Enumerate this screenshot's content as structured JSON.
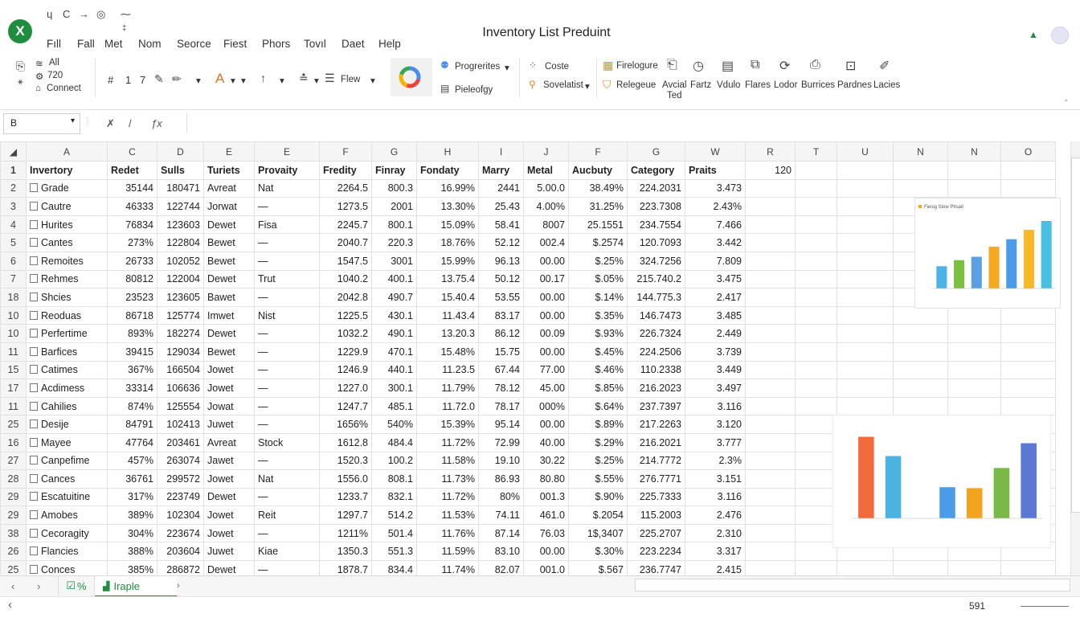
{
  "window": {
    "title": "Inventory List Preduint",
    "app_icon": "X",
    "quick_access": [
      "ɥ",
      "C",
      "→",
      "◎",
      "⁓"
    ]
  },
  "menu": [
    "Fıll",
    "Fall",
    "Met",
    "Nom",
    "Seorce",
    "Fiest",
    "Phors",
    "Tovıl",
    "Daet",
    "Help"
  ],
  "ribbon": {
    "connect_group": {
      "all": "All",
      "value": "720",
      "connect": "Connect"
    },
    "format_items": [
      "#",
      "1",
      "7"
    ],
    "view_label": "Flew",
    "progresses_label": "Progrerites",
    "pieologry_label": "Pieleofgy",
    "costs_label": "Coste",
    "sovelatist_label": "Sovelatist",
    "big_buttons": [
      {
        "label": "Firelogure",
        "icon": "table-icon"
      },
      {
        "label": "Relegeue",
        "icon": "filter-icon"
      },
      {
        "label": "Avcial",
        "sub": "Ted",
        "icon": "chart-icon"
      },
      {
        "label": "Fartz",
        "icon": "clock-icon"
      },
      {
        "label": "Vdulo",
        "icon": "doc-icon"
      },
      {
        "label": "Flares",
        "icon": "share-icon"
      },
      {
        "label": "Lodor",
        "icon": "refresh-icon"
      },
      {
        "label": "Burrices",
        "icon": "form-icon"
      },
      {
        "label": "Pardnes",
        "icon": "text-icon"
      },
      {
        "label": "Lacies",
        "icon": "pen-icon"
      }
    ]
  },
  "namebox": "B",
  "formula_tools": [
    "✗",
    "/",
    "ƒx"
  ],
  "columns": [
    "A",
    "C",
    "D",
    "E",
    "E",
    "F",
    "G",
    "H",
    "I",
    "J",
    "F",
    "G",
    "W",
    "R",
    "T",
    "U",
    "N",
    "N",
    "O"
  ],
  "grid": {
    "header_row_number": "1",
    "headers": [
      "Invertory",
      "Redet",
      "Sulls",
      "Turiets",
      "Provaity",
      "Fredity",
      "Finray",
      "Fondaty",
      "Marry",
      "Metal",
      "Aucbuty",
      "Category",
      "Praits",
      "120"
    ],
    "rows": [
      {
        "rn": "2",
        "cells": [
          "Grade",
          "35144",
          "180471",
          "Avreat",
          "Nat",
          "2264.5",
          "800.3",
          "16.99%",
          "2441",
          "5.00.0",
          "38.49%",
          "224.2031",
          "3.473"
        ]
      },
      {
        "rn": "3",
        "cells": [
          "Cautre",
          "46333",
          "122744",
          "Jorwat",
          "—",
          "1273.5",
          "2001",
          "13.30%",
          "25.43",
          "4.00%",
          "31.25%",
          "223.7308",
          "2.43%"
        ]
      },
      {
        "rn": "4",
        "cells": [
          "Hurites",
          "76834",
          "123603",
          "Dewet",
          "Fisa",
          "2245.7",
          "800.1",
          "15.09%",
          "58.41",
          "8007",
          "25.1551",
          "234.7554",
          "7.466"
        ]
      },
      {
        "rn": "5",
        "cells": [
          "Cantes",
          "273%",
          "122804",
          "Bewet",
          "—",
          "2040.7",
          "220.3",
          "18.76%",
          "52.12",
          "002.4",
          "$.2574",
          "120.7093",
          "3.442"
        ]
      },
      {
        "rn": "6",
        "cells": [
          "Remoites",
          "26733",
          "102052",
          "Bewet",
          "—",
          "1547.5",
          "3001",
          "15.99%",
          "96.13",
          "00.00",
          "$.25%",
          "324.7256",
          "7.809"
        ]
      },
      {
        "rn": "7",
        "cells": [
          "Rehmes",
          "80812",
          "122004",
          "Dewet",
          "Trut",
          "1040.2",
          "400.1",
          "13.75.4",
          "50.12",
          "00.17",
          "$.05%",
          "215.740.2",
          "3.475"
        ]
      },
      {
        "rn": "18",
        "cells": [
          "Shcies",
          "23523",
          "123605",
          "Bawet",
          "—",
          "2042.8",
          "490.7",
          "15.40.4",
          "53.55",
          "00.00",
          "$.14%",
          "144.775.3",
          "2.417"
        ]
      },
      {
        "rn": "10",
        "cells": [
          "Reoduas",
          "86718",
          "125774",
          "Imwet",
          "Nist",
          "1225.5",
          "430.1",
          "11.43.4",
          "83.17",
          "00.00",
          "$.35%",
          "146.7473",
          "3.485"
        ]
      },
      {
        "rn": "10",
        "cells": [
          "Perfertime",
          "893%",
          "182274",
          "Dewet",
          "—",
          "1032.2",
          "490.1",
          "13.20.3",
          "86.12",
          "00.09",
          "$.93%",
          "226.7324",
          "2.449"
        ]
      },
      {
        "rn": "11",
        "cells": [
          "Barfices",
          "39415",
          "129034",
          "Bewet",
          "—",
          "1229.9",
          "470.1",
          "15.48%",
          "15.75",
          "00.00",
          "$.45%",
          "224.2506",
          "3.739"
        ]
      },
      {
        "rn": "15",
        "cells": [
          "Catimes",
          "367%",
          "166504",
          "Jowet",
          "—",
          "1246.9",
          "440.1",
          "11.23.5",
          "67.44",
          "77.00",
          "$.46%",
          "110.2338",
          "3.449"
        ]
      },
      {
        "rn": "17",
        "cells": [
          "Acdimess",
          "33314",
          "106636",
          "Jowet",
          "—",
          "1227.0",
          "300.1",
          "11.79%",
          "78.12",
          "45.00",
          "$.85%",
          "216.2023",
          "3.497"
        ]
      },
      {
        "rn": "11",
        "cells": [
          "Cahilies",
          "874%",
          "125554",
          "Jowat",
          "—",
          "1247.7",
          "485.1",
          "11.72.0",
          "78.17",
          "000%",
          "$.64%",
          "237.7397",
          "3.116"
        ]
      },
      {
        "rn": "25",
        "cells": [
          "Desije",
          "84791",
          "102413",
          "Juwet",
          "—",
          "1656%",
          "540%",
          "15.39%",
          "95.14",
          "00.00",
          "$.89%",
          "217.2263",
          "3.120"
        ]
      },
      {
        "rn": "16",
        "cells": [
          "Mayee",
          "47764",
          "203461",
          "Avreat",
          "Stock",
          "1612.8",
          "484.4",
          "11.72%",
          "72.99",
          "40.00",
          "$.29%",
          "216.2021",
          "3.777"
        ]
      },
      {
        "rn": "27",
        "cells": [
          "Canpefime",
          "457%",
          "263074",
          "Jawet",
          "—",
          "1520.3",
          "100.2",
          "11.58%",
          "19.10",
          "30.22",
          "$.25%",
          "214.7772",
          "2.3%"
        ]
      },
      {
        "rn": "28",
        "cells": [
          "Cances",
          "36761",
          "299572",
          "Jowet",
          "Nat",
          "1556.0",
          "808.1",
          "11.73%",
          "86.93",
          "80.80",
          "$.55%",
          "276.7771",
          "3.151"
        ]
      },
      {
        "rn": "29",
        "cells": [
          "Escatuitine",
          "317%",
          "223749",
          "Dewet",
          "—",
          "1233.7",
          "832.1",
          "11.72%",
          "80%",
          "001.3",
          "$.90%",
          "225.7333",
          "3.116"
        ]
      },
      {
        "rn": "29",
        "cells": [
          "Amobes",
          "389%",
          "102304",
          "Jowet",
          "Reit",
          "1297.7",
          "514.2",
          "11.53%",
          "74.11",
          "461.0",
          "$.2054",
          "115.2003",
          "2.476"
        ]
      },
      {
        "rn": "38",
        "cells": [
          "Cecoragity",
          "304%",
          "223674",
          "Jowet",
          "—",
          "1211%",
          "501.4",
          "11.76%",
          "87.14",
          "76.03",
          "1$,3407",
          "225.2707",
          "2.310"
        ]
      },
      {
        "rn": "26",
        "cells": [
          "Flancies",
          "388%",
          "203604",
          "Juwet",
          "Kiae",
          "1350.3",
          "551.3",
          "11.59%",
          "83.10",
          "00.00",
          "$.30%",
          "223.2234",
          "3.317"
        ]
      },
      {
        "rn": "25",
        "cells": [
          "Conces",
          "385%",
          "286872",
          "Dewet",
          "—",
          "1878.7",
          "834.4",
          "11.74%",
          "82.07",
          "001.0",
          "$.567",
          "236.7747",
          "2.415"
        ]
      }
    ]
  },
  "chart_data": [
    {
      "type": "bar",
      "title": "Fiesig Slow Plrsait",
      "categories": [
        "",
        "",
        "",
        "",
        "",
        "",
        ""
      ],
      "values": [
        0.33,
        0.42,
        0.47,
        0.62,
        0.73,
        0.87,
        1.0
      ],
      "colors": [
        "#4ab3e8",
        "#7ac142",
        "#5aa0e0",
        "#f4a91e",
        "#4a9be8",
        "#f7b928",
        "#48c0e0"
      ],
      "ylim": [
        0,
        1
      ]
    },
    {
      "type": "bar",
      "title": "",
      "categories": [
        "",
        "",
        "",
        "",
        "",
        "",
        "",
        ""
      ],
      "values": [
        0.89,
        0.68,
        0.0,
        0.34,
        0.33,
        0.55,
        0.82
      ],
      "colors": [
        "#f26a3c",
        "#4ab3e0",
        "#ffffff",
        "#4a9be8",
        "#f4a31e",
        "#7ab84a",
        "#5a78d4"
      ],
      "ylim": [
        0,
        1
      ]
    }
  ],
  "sheets": {
    "tab1": "%",
    "tab2": "Iraple",
    "nav_prev": "‹",
    "nav_next": "›"
  },
  "status": {
    "zoom": "591",
    "left_arrow": "‹"
  }
}
